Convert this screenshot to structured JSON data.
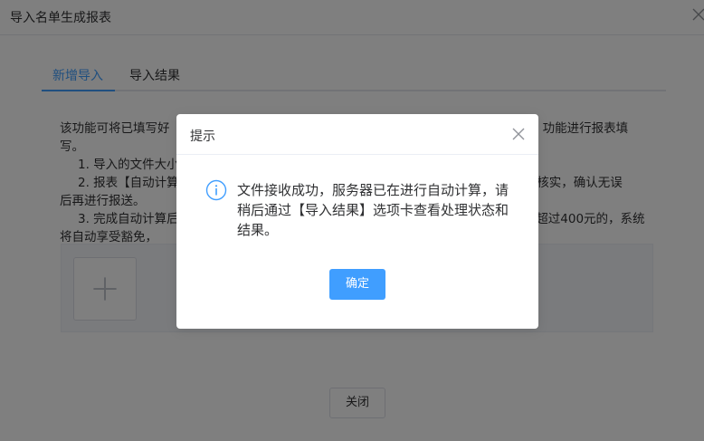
{
  "dialog": {
    "title": "导入名单生成报表",
    "close_label": "关闭"
  },
  "tabs": [
    {
      "label": "新增导入",
      "active": true
    },
    {
      "label": "导入结果",
      "active": false
    }
  ],
  "description": {
    "line1_left": "该功能可将已填写好",
    "line1_right": "】功能进行报表填",
    "line2": "写。",
    "item1": "1. 导入的文件大小",
    "item2_left": "2. 报表【自动计算",
    "item2_right": "进行核实，确认无误",
    "item2_cont": "后再进行报送。",
    "item3_left": "3. 完成自动计算后",
    "item3_right": "超过400元的，系统",
    "item3_cont": "将自动享受豁免，"
  },
  "message_box": {
    "title": "提示",
    "message": "文件接收成功，服务器已在进行自动计算，请稍后通过【导入结果】选项卡查看处理状态和结果。",
    "confirm_label": "确定",
    "icon": "info-icon"
  },
  "colors": {
    "accent": "#409eff",
    "overlay": "rgba(0,0,0,0.5)"
  }
}
